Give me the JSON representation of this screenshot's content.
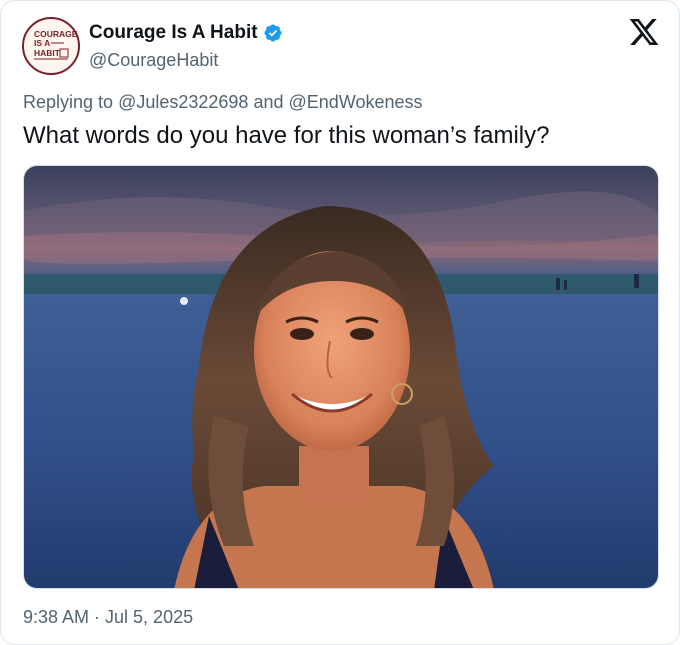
{
  "author": {
    "display_name": "Courage Is A Habit",
    "handle": "@CourageHabit",
    "verified": true,
    "avatar_logo_text": [
      "COURAGE",
      "IS A",
      "HABIT"
    ]
  },
  "reply": {
    "prefix": "Replying to ",
    "mention_1": "@Jules2322698",
    "joiner": " and ",
    "mention_2": "@EndWokeness"
  },
  "tweet": {
    "text": "What words do you have for this woman’s family?",
    "timestamp": "9:38 AM · Jul 5, 2025"
  },
  "media": {
    "icon": "photo-woman-on-beach-at-dusk"
  },
  "colors": {
    "text_primary": "#0f1419",
    "text_secondary": "#536471",
    "verified_blue": "#1d9bf0",
    "avatar_maroon": "#7a1f2b"
  }
}
